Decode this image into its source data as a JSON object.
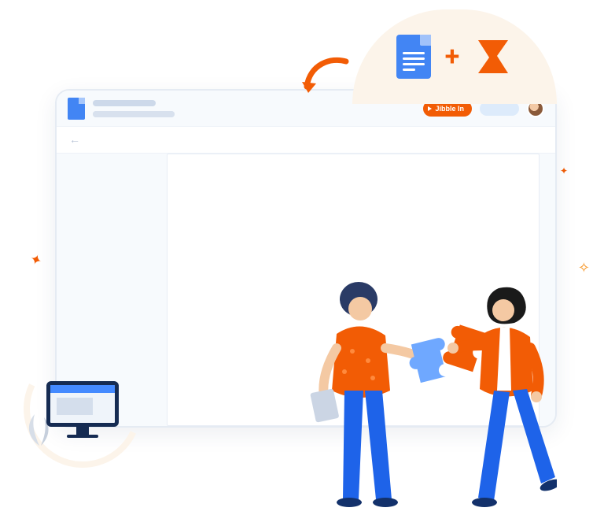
{
  "integration": {
    "plus": "+",
    "docs_icon": "google-docs",
    "partner_icon": "jibble-hourglass"
  },
  "window": {
    "app_icon": "google-docs-icon",
    "jibble_button_label": "Jibble In",
    "back_glyph": "←"
  },
  "colors": {
    "accent_orange": "#F25C05",
    "accent_blue": "#4285F4",
    "cream": "#FCF4EA",
    "navy": "#152B52"
  }
}
